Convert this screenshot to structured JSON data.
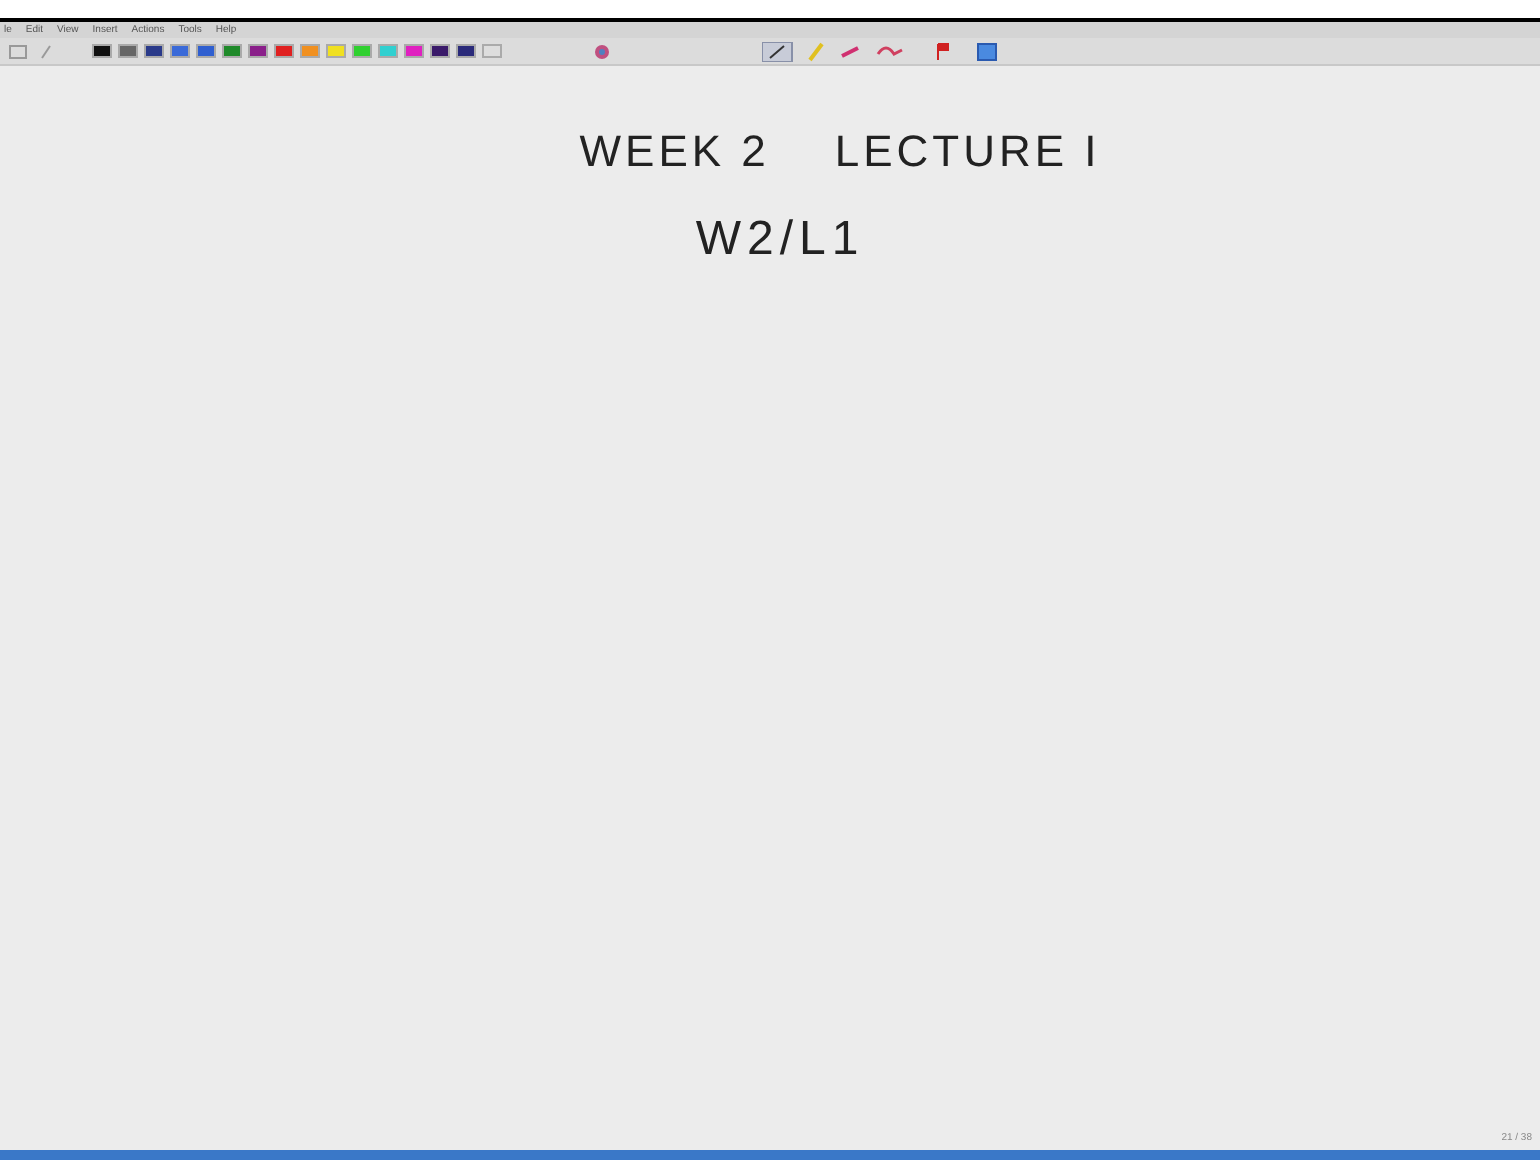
{
  "menu_bar": [
    "le",
    "Edit",
    "View",
    "Insert",
    "Actions",
    "Tools",
    "Help"
  ],
  "palette": [
    {
      "color": "#111111"
    },
    {
      "color": "#666666"
    },
    {
      "color": "#2a3a8a"
    },
    {
      "color": "#3a6ad8"
    },
    {
      "color": "#2f5fd0"
    },
    {
      "color": "#1f8a2a"
    },
    {
      "color": "#8a1f8a"
    },
    {
      "color": "#e02020"
    },
    {
      "color": "#f09020"
    },
    {
      "color": "#f0e020"
    },
    {
      "color": "#30d030"
    },
    {
      "color": "#30d0d0"
    },
    {
      "color": "#e020c0"
    },
    {
      "color": "#3a1a6a"
    },
    {
      "color": "#2a2a7a"
    },
    {
      "color": "#dddddd"
    }
  ],
  "canvas": {
    "title": "WEEK 2    LECTURE I",
    "subtitle": "W2/L1"
  },
  "page_number": "21 / 38"
}
